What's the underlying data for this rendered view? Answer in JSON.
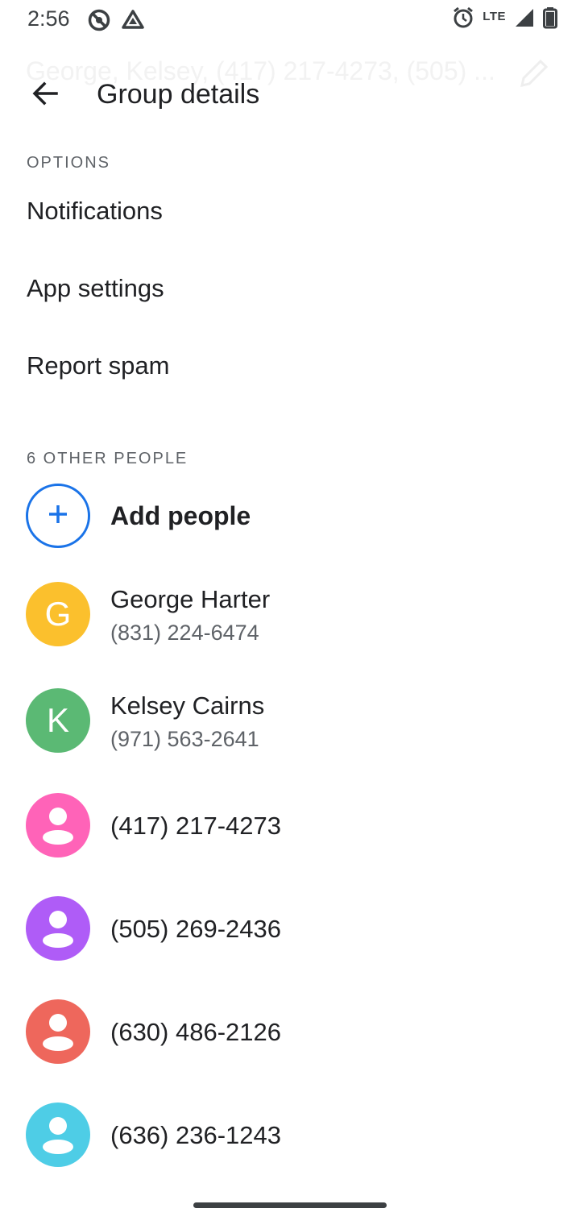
{
  "status_bar": {
    "time": "2:56",
    "network": "LTE",
    "icons": [
      "do-not-disturb-icon",
      "drive-icon",
      "alarm-icon",
      "signal-icon",
      "battery-icon"
    ]
  },
  "header": {
    "ghost_title": "George, Kelsey, (417) 217-4273, (505) ...",
    "title": "Group details",
    "back_icon": "arrow-back-icon",
    "edit_icon": "pencil-icon"
  },
  "options": {
    "header": "OPTIONS",
    "items": [
      {
        "label": "Notifications"
      },
      {
        "label": "App settings"
      },
      {
        "label": "Report spam"
      }
    ]
  },
  "people": {
    "header": "6 OTHER PEOPLE",
    "add_label": "Add people",
    "accent_color": "#1a73e8",
    "members": [
      {
        "name": "George Harter",
        "phone": "(831) 224-6474",
        "initial": "G",
        "color": "#fbc02d"
      },
      {
        "name": "Kelsey Cairns",
        "phone": "(971) 563-2641",
        "initial": "K",
        "color": "#5bb974"
      },
      {
        "name": "(417) 217-4273",
        "color": "#ff63b8"
      },
      {
        "name": "(505) 269-2436",
        "color": "#af5cf7"
      },
      {
        "name": "(630) 486-2126",
        "color": "#ee675c"
      },
      {
        "name": "(636) 236-1243",
        "color": "#4ecde6"
      }
    ]
  }
}
